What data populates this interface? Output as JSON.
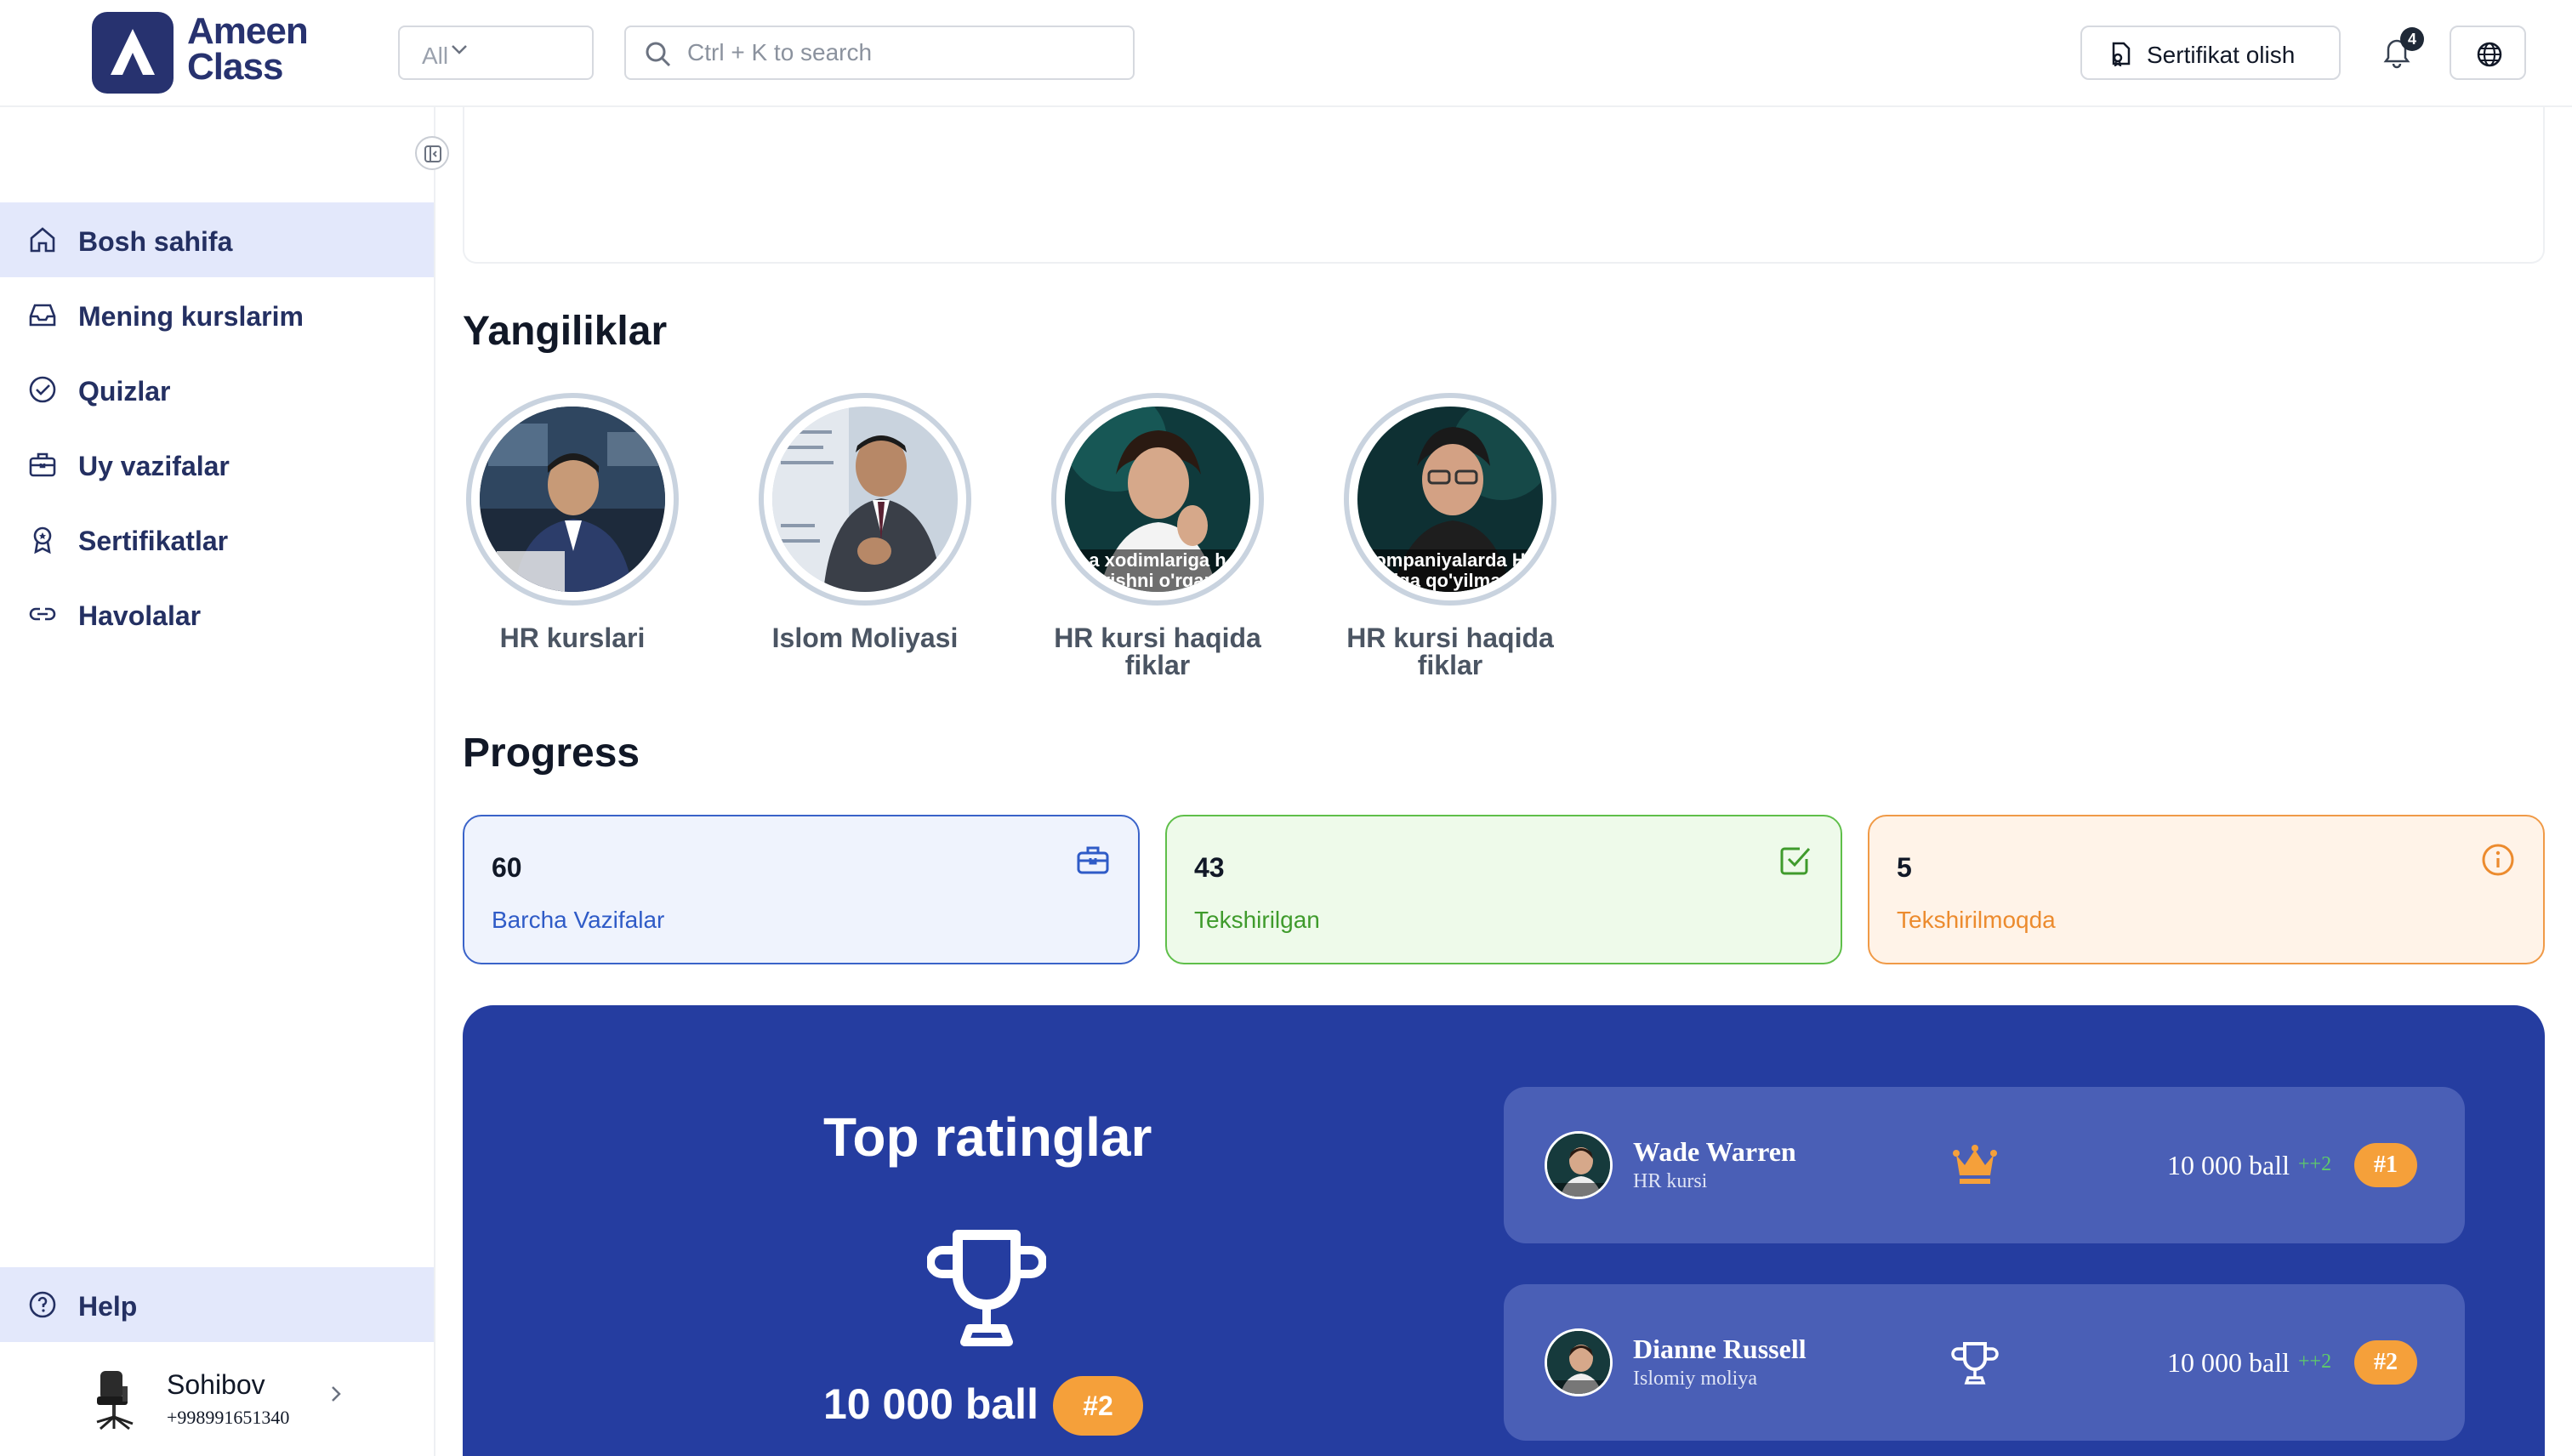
{
  "header": {
    "logo_line1": "Ameen",
    "logo_line2": "Class",
    "filter_value": "All",
    "search_placeholder": "Ctrl + K to search",
    "certificate_button": "Sertifikat olish",
    "notifications_count": "4"
  },
  "sidebar": {
    "items": [
      {
        "label": "Bosh sahifa",
        "icon": "home-icon",
        "active": true
      },
      {
        "label": "Mening kurslarim",
        "icon": "inbox-icon"
      },
      {
        "label": "Quizlar",
        "icon": "check-circle-icon"
      },
      {
        "label": "Uy vazifalar",
        "icon": "briefcase-icon"
      },
      {
        "label": "Sertifikatlar",
        "icon": "award-icon"
      },
      {
        "label": "Havolalar",
        "icon": "link-icon"
      }
    ],
    "help_label": "Help",
    "user": {
      "name": "Sohibov",
      "phone": "+998991651340"
    }
  },
  "news": {
    "title": "Yangiliklar",
    "stories": [
      {
        "caption": "HR kurslari"
      },
      {
        "caption": "Islom Moliyasi"
      },
      {
        "caption": "HR kursi haqida fiklar",
        "overlay": "a xodimlariga h\nvishni o'rgan"
      },
      {
        "caption": "HR kursi haqida fiklar",
        "overlay": "ompaniyalarda H\nilga qo'yilmag"
      }
    ]
  },
  "progress": {
    "title": "Progress",
    "cards": [
      {
        "value": "60",
        "label": "Barcha Vazifalar",
        "color": "#2f5bc7"
      },
      {
        "value": "43",
        "label": "Tekshirilgan",
        "color": "#3f9b2c"
      },
      {
        "value": "5",
        "label": "Tekshirilmoqda",
        "color": "#ec8b2e"
      }
    ]
  },
  "rating": {
    "title": "Top ratinglar",
    "my_points": "10 000 ball",
    "my_rank": "#2",
    "rows": [
      {
        "name": "Wade Warren",
        "course": "HR kursi",
        "points": "10 000 ball",
        "delta": "++2",
        "rank": "#1",
        "icon": "crown-icon"
      },
      {
        "name": "Dianne Russell",
        "course": "Islomiy moliya",
        "points": "10 000 ball",
        "delta": "++2",
        "rank": "#2",
        "icon": "trophy-icon"
      }
    ]
  }
}
